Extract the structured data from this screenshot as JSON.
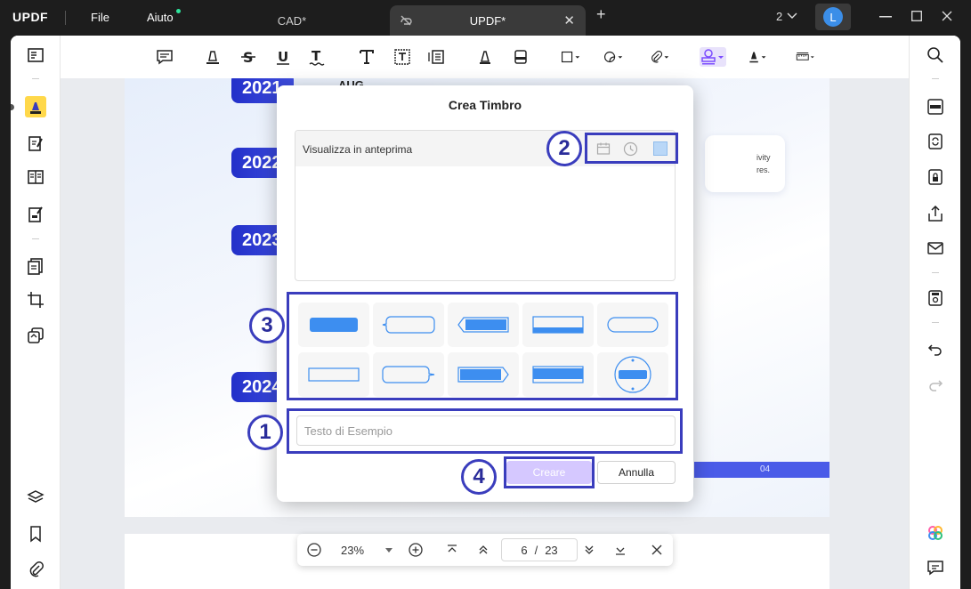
{
  "app": {
    "logo": "UPDF",
    "menu": [
      "File",
      "Aiuto"
    ],
    "tabs": [
      {
        "label": "CAD*",
        "active": false
      },
      {
        "label": "UPDF*",
        "active": true
      }
    ],
    "window_count": "2",
    "user_initial": "L"
  },
  "document": {
    "years": [
      "2021",
      "2022",
      "2023",
      "2024"
    ],
    "obscured_label": "AUG",
    "card_text": [
      "ivity",
      "res."
    ],
    "band_text": "04"
  },
  "dialog": {
    "title": "Crea Timbro",
    "preview_label": "Visualizza in anteprima",
    "sample_placeholder": "Testo di Esempio",
    "create_label": "Creare",
    "cancel_label": "Annulla"
  },
  "zoom": {
    "level": "23%",
    "current_page": "6",
    "separator": "/",
    "total_pages": "23"
  },
  "annotations": [
    "1",
    "2",
    "3",
    "4"
  ],
  "colors": {
    "accent": "#3a3dbd",
    "stamp_blue": "#3d8ef0",
    "year_tag": "#2330c9",
    "create_button": "#d5c8ff"
  }
}
